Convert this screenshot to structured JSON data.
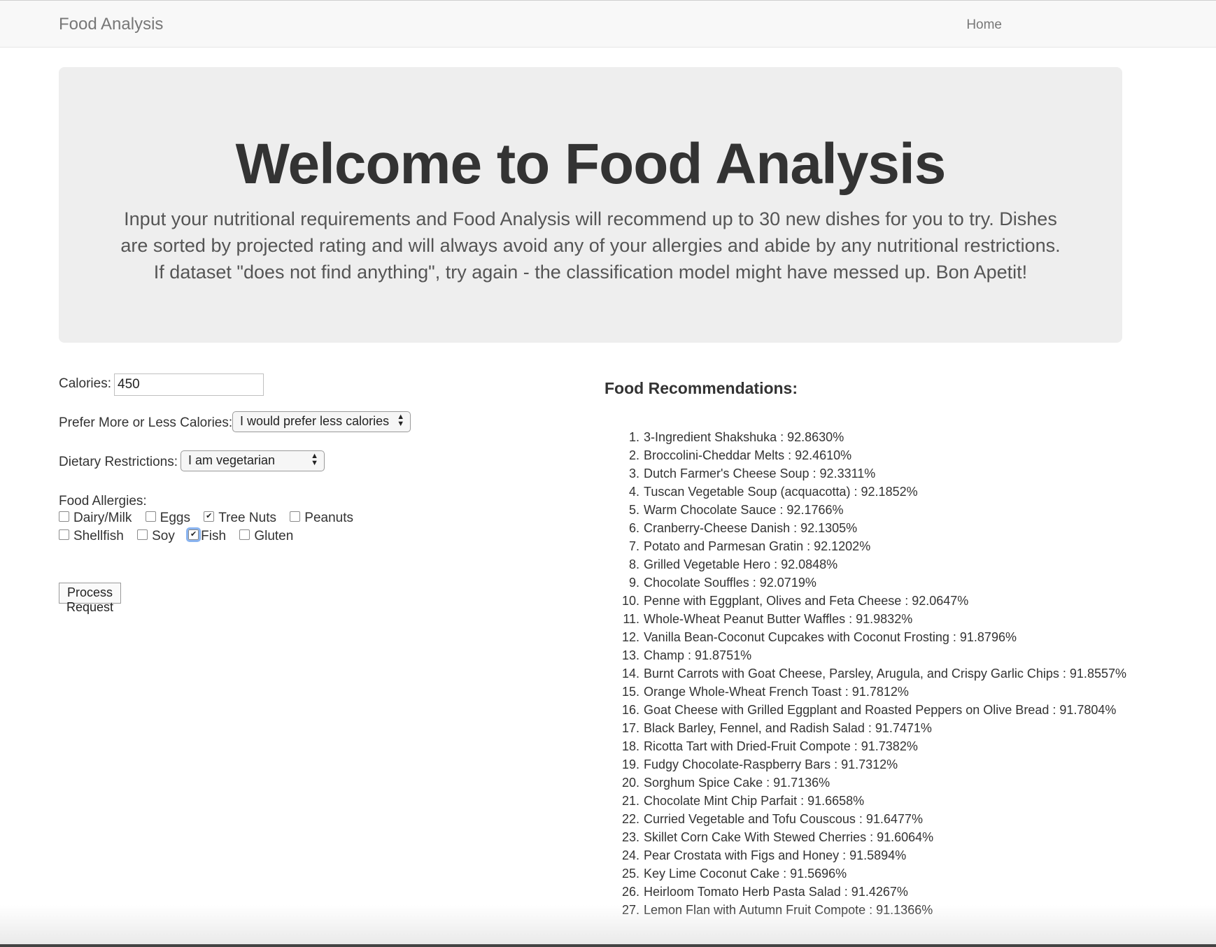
{
  "navbar": {
    "brand": "Food Analysis",
    "home": "Home"
  },
  "jumbotron": {
    "title": "Welcome to Food Analysis",
    "lead": "Input your nutritional requirements and Food Analysis will recommend up to 30 new dishes for you to try. Dishes are sorted by projected rating and will always avoid any of your allergies and abide by any nutritional restrictions. If dataset \"does not find anything\", try again - the classification model might have messed up. Bon Apetit!"
  },
  "form": {
    "calories_label": "Calories:",
    "calories_value": "450",
    "prefer_label": "Prefer More or Less Calories:",
    "prefer_value": "I would prefer less calories",
    "diet_label": "Dietary Restrictions:",
    "diet_value": "I am vegetarian",
    "allergies_label": "Food Allergies:",
    "allergies": [
      {
        "label": "Dairy/Milk",
        "checked": false
      },
      {
        "label": "Eggs",
        "checked": false
      },
      {
        "label": "Tree Nuts",
        "checked": true
      },
      {
        "label": "Peanuts",
        "checked": false
      },
      {
        "label": "Shellfish",
        "checked": false
      },
      {
        "label": "Soy",
        "checked": false
      },
      {
        "label": "Fish",
        "checked": true,
        "focused": true
      },
      {
        "label": "Gluten",
        "checked": false
      }
    ],
    "submit_label": "Process Request"
  },
  "recommendations": {
    "title": "Food Recommendations:",
    "items": [
      "3-Ingredient Shakshuka : 92.8630%",
      "Broccolini-Cheddar Melts : 92.4610%",
      "Dutch Farmer's Cheese Soup : 92.3311%",
      "Tuscan Vegetable Soup (acquacotta) : 92.1852%",
      "Warm Chocolate Sauce : 92.1766%",
      "Cranberry-Cheese Danish : 92.1305%",
      "Potato and Parmesan Gratin : 92.1202%",
      "Grilled Vegetable Hero : 92.0848%",
      "Chocolate Souffles : 92.0719%",
      "Penne with Eggplant, Olives and Feta Cheese : 92.0647%",
      "Whole-Wheat Peanut Butter Waffles : 91.9832%",
      "Vanilla Bean-Coconut Cupcakes with Coconut Frosting : 91.8796%",
      "Champ : 91.8751%",
      "Burnt Carrots with Goat Cheese, Parsley, Arugula, and Crispy Garlic Chips : 91.8557%",
      "Orange Whole-Wheat French Toast : 91.7812%",
      "Goat Cheese with Grilled Eggplant and Roasted Peppers on Olive Bread : 91.7804%",
      "Black Barley, Fennel, and Radish Salad : 91.7471%",
      "Ricotta Tart with Dried-Fruit Compote : 91.7382%",
      "Fudgy Chocolate-Raspberry Bars : 91.7312%",
      "Sorghum Spice Cake : 91.7136%",
      "Chocolate Mint Chip Parfait : 91.6658%",
      "Curried Vegetable and Tofu Couscous : 91.6477%",
      "Skillet Corn Cake With Stewed Cherries : 91.6064%",
      "Pear Crostata with Figs and Honey : 91.5894%",
      "Key Lime Coconut Cake : 91.5696%",
      "Heirloom Tomato Herb Pasta Salad : 91.4267%",
      "Lemon Flan with Autumn Fruit Compote : 91.1366%"
    ]
  }
}
